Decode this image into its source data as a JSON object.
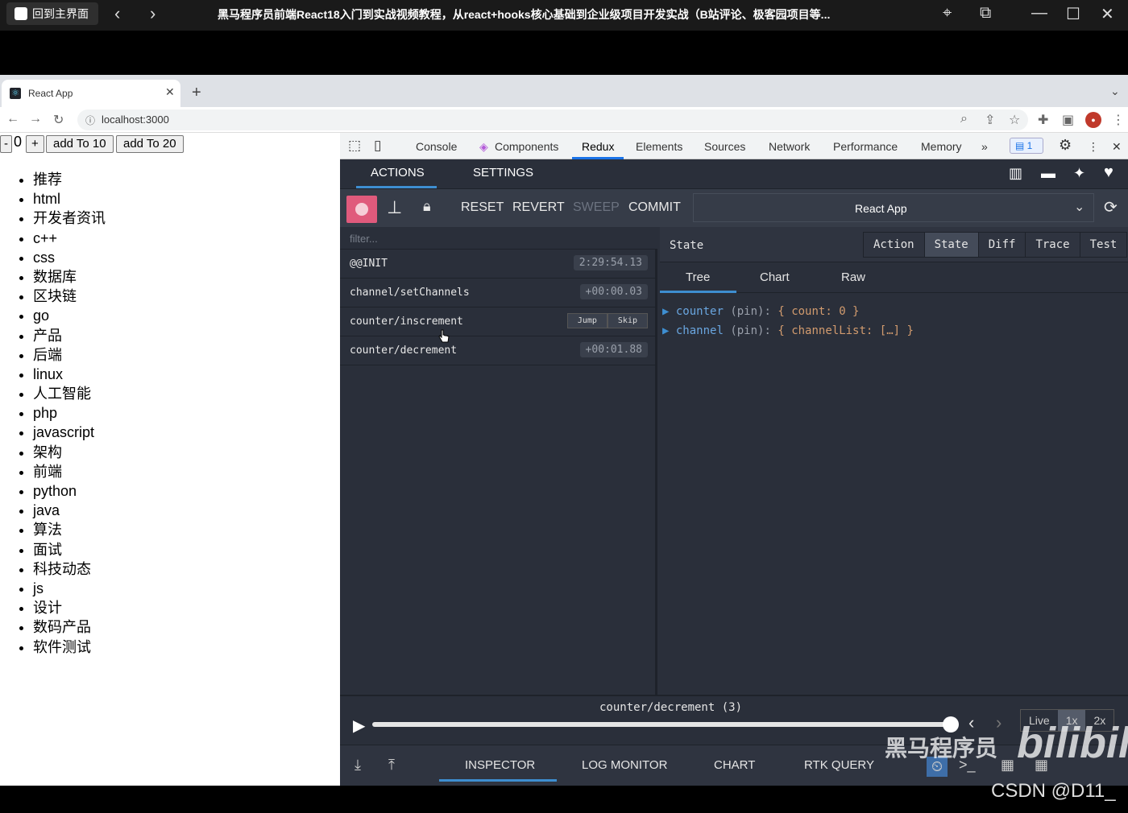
{
  "player": {
    "home_label": "回到主界面",
    "title": "黑马程序员前端React18入门到实战视频教程，从react+hooks核心基础到企业级项目开发实战（B站评论、极客园项目等..."
  },
  "browser": {
    "tab_title": "React App",
    "url": "localhost:3000"
  },
  "page": {
    "minus_label": "-",
    "count": "0",
    "plus_label": "+",
    "add10_label": "add To 10",
    "add20_label": "add To 20",
    "topics": [
      "推荐",
      "html",
      "开发者资讯",
      "c++",
      "css",
      "数据库",
      "区块链",
      "go",
      "产品",
      "后端",
      "linux",
      "人工智能",
      "php",
      "javascript",
      "架构",
      "前端",
      "python",
      "java",
      "算法",
      "面试",
      "科技动态",
      "js",
      "设计",
      "数码产品",
      "软件测试"
    ]
  },
  "devtools": {
    "tabs": [
      "Console",
      "Components",
      "Redux",
      "Elements",
      "Sources",
      "Network",
      "Performance",
      "Memory"
    ],
    "issues_count": "1"
  },
  "redux": {
    "head_tabs": [
      "ACTIONS",
      "SETTINGS"
    ],
    "controls": [
      "RESET",
      "REVERT",
      "SWEEP",
      "COMMIT"
    ],
    "instance": "React App",
    "filter_placeholder": "filter...",
    "actions": [
      {
        "name": "@@INIT",
        "time": "2:29:54.13"
      },
      {
        "name": "channel/setChannels",
        "time": "+00:00.03"
      },
      {
        "name": "counter/inscrement",
        "jump": "Jump",
        "skip": "Skip"
      },
      {
        "name": "counter/decrement",
        "time": "+00:01.88"
      }
    ],
    "state_label": "State",
    "monitor_tabs": [
      "Action",
      "State",
      "Diff",
      "Trace",
      "Test"
    ],
    "sub_tabs": [
      "Tree",
      "Chart",
      "Raw"
    ],
    "tree": [
      {
        "key": "counter",
        "pin": "(pin):",
        "val": "{ count: 0 }"
      },
      {
        "key": "channel",
        "pin": "(pin):",
        "val": "{ channelList: […] }"
      }
    ],
    "slider_label": "counter/decrement (3)",
    "speed": [
      "Live",
      "1x",
      "2x"
    ],
    "bottom_tabs": [
      "INSPECTOR",
      "LOG MONITOR",
      "CHART",
      "RTK QUERY"
    ]
  },
  "watermark": {
    "heima": "黑马程序员",
    "bili": "bilibili",
    "csdn": "CSDN @D11_"
  }
}
